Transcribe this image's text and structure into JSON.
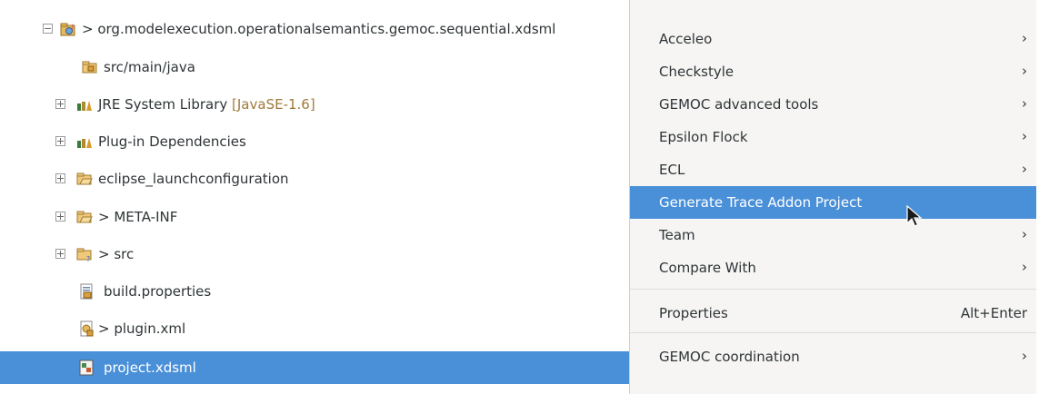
{
  "tree": {
    "project": {
      "prefix": "> ",
      "label": "org.modelexecution.operationalsemantics.gemoc.sequential.xdsml"
    },
    "items": [
      {
        "label": "src/main/java"
      },
      {
        "label": "JRE System Library",
        "decoration": "[JavaSE-1.6]"
      },
      {
        "label": "Plug-in Dependencies"
      },
      {
        "label": "eclipse_launchconfiguration"
      },
      {
        "label": "> META-INF"
      },
      {
        "label": "> src"
      },
      {
        "label": "build.properties"
      },
      {
        "label": "> plugin.xml"
      },
      {
        "label": "project.xdsml"
      }
    ]
  },
  "menu": {
    "items": [
      {
        "label": "Acceleo",
        "submenu": "›"
      },
      {
        "label": "Checkstyle",
        "submenu": "›"
      },
      {
        "label": "GEMOC advanced tools",
        "submenu": "›"
      },
      {
        "label": "Epsilon Flock",
        "submenu": "›"
      },
      {
        "label": "ECL",
        "submenu": "›"
      },
      {
        "label": "Generate Trace Addon Project"
      },
      {
        "label": "Team",
        "submenu": "›"
      },
      {
        "label": "Compare With",
        "submenu": "›"
      },
      {
        "label": "Properties",
        "accelerator": "Alt+Enter"
      },
      {
        "label": "GEMOC coordination",
        "submenu": "›"
      }
    ],
    "highlighted": "Generate Trace Addon Project"
  },
  "colors": {
    "selection": "#4a90d9",
    "menu_bg": "#f6f5f4",
    "decoration": "#a07a3a"
  }
}
